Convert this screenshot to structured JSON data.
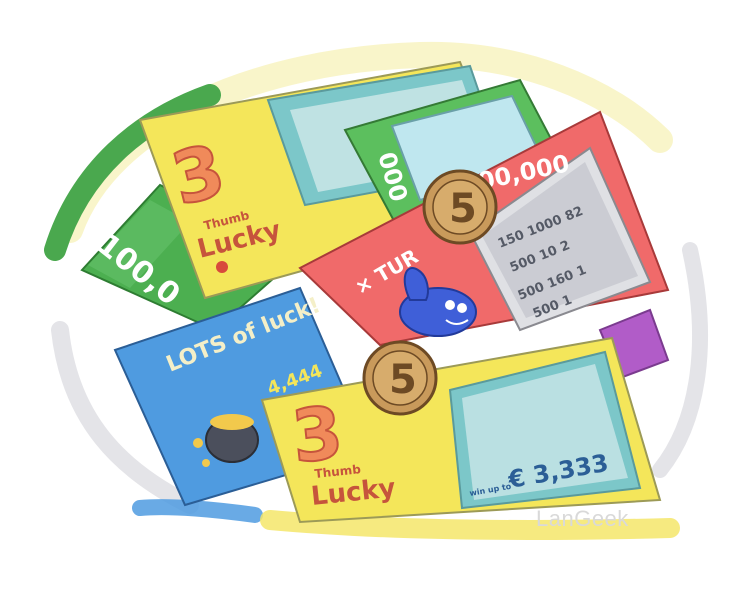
{
  "ticket_back_left": {
    "amount": "100,0",
    "color": "#4caf50"
  },
  "ticket_yellow_top": {
    "number": "3",
    "title_small": "Thumb",
    "title": "Lucky",
    "color": "#f4e65a"
  },
  "ticket_green_top": {
    "amount": "000",
    "color": "#5cbf5e"
  },
  "ticket_red": {
    "top_amount": "00,000",
    "label": "× TUR",
    "panel_numbers": [
      "150 1000 82",
      "500 10 2",
      "500 160 1",
      "500 1"
    ],
    "color": "#f06a6a"
  },
  "ticket_blue": {
    "headline": "LOTS of luck!",
    "amount": "4,444",
    "color": "#4f9be0"
  },
  "ticket_yellow_bottom": {
    "number": "3",
    "title_small": "Thumb",
    "title": "Lucky",
    "prize_prefix": "win up to",
    "prize": "€ 3,333",
    "color": "#f4e65a"
  },
  "coins": [
    {
      "label": "5",
      "name": "coin-top"
    },
    {
      "label": "5",
      "name": "coin-bottom"
    }
  ],
  "watermark": "LanGeek"
}
